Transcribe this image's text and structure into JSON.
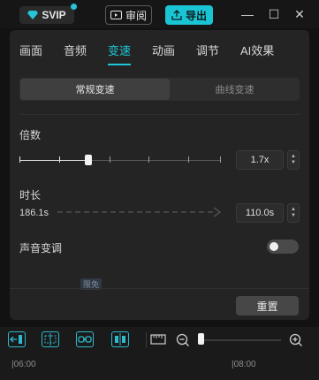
{
  "topbar": {
    "svip_label": "SVIP",
    "review_label": "审阅",
    "export_label": "导出",
    "minimize_glyph": "—",
    "maximize_glyph": "☐",
    "close_glyph": "✕"
  },
  "tabs": [
    {
      "label": "画面"
    },
    {
      "label": "音频"
    },
    {
      "label": "变速",
      "active": true
    },
    {
      "label": "动画"
    },
    {
      "label": "调节"
    },
    {
      "label": "AI效果"
    }
  ],
  "speed_mode": {
    "options": [
      "常规变速",
      "曲线变速"
    ],
    "selected": "常规变速"
  },
  "multiplier": {
    "label": "倍数",
    "value": "1.7x",
    "slider_fraction": 0.34
  },
  "duration": {
    "label": "时长",
    "original": "186.1s",
    "value": "110.0s"
  },
  "pitch": {
    "label": "声音变调",
    "enabled": false
  },
  "hint_badge": "限免",
  "reset_label": "重置",
  "ruler": {
    "marks": [
      "|06:00",
      "|08:00"
    ]
  },
  "colors": {
    "accent": "#19c5d5",
    "panel_bg": "#242424",
    "page_bg": "#121212"
  }
}
